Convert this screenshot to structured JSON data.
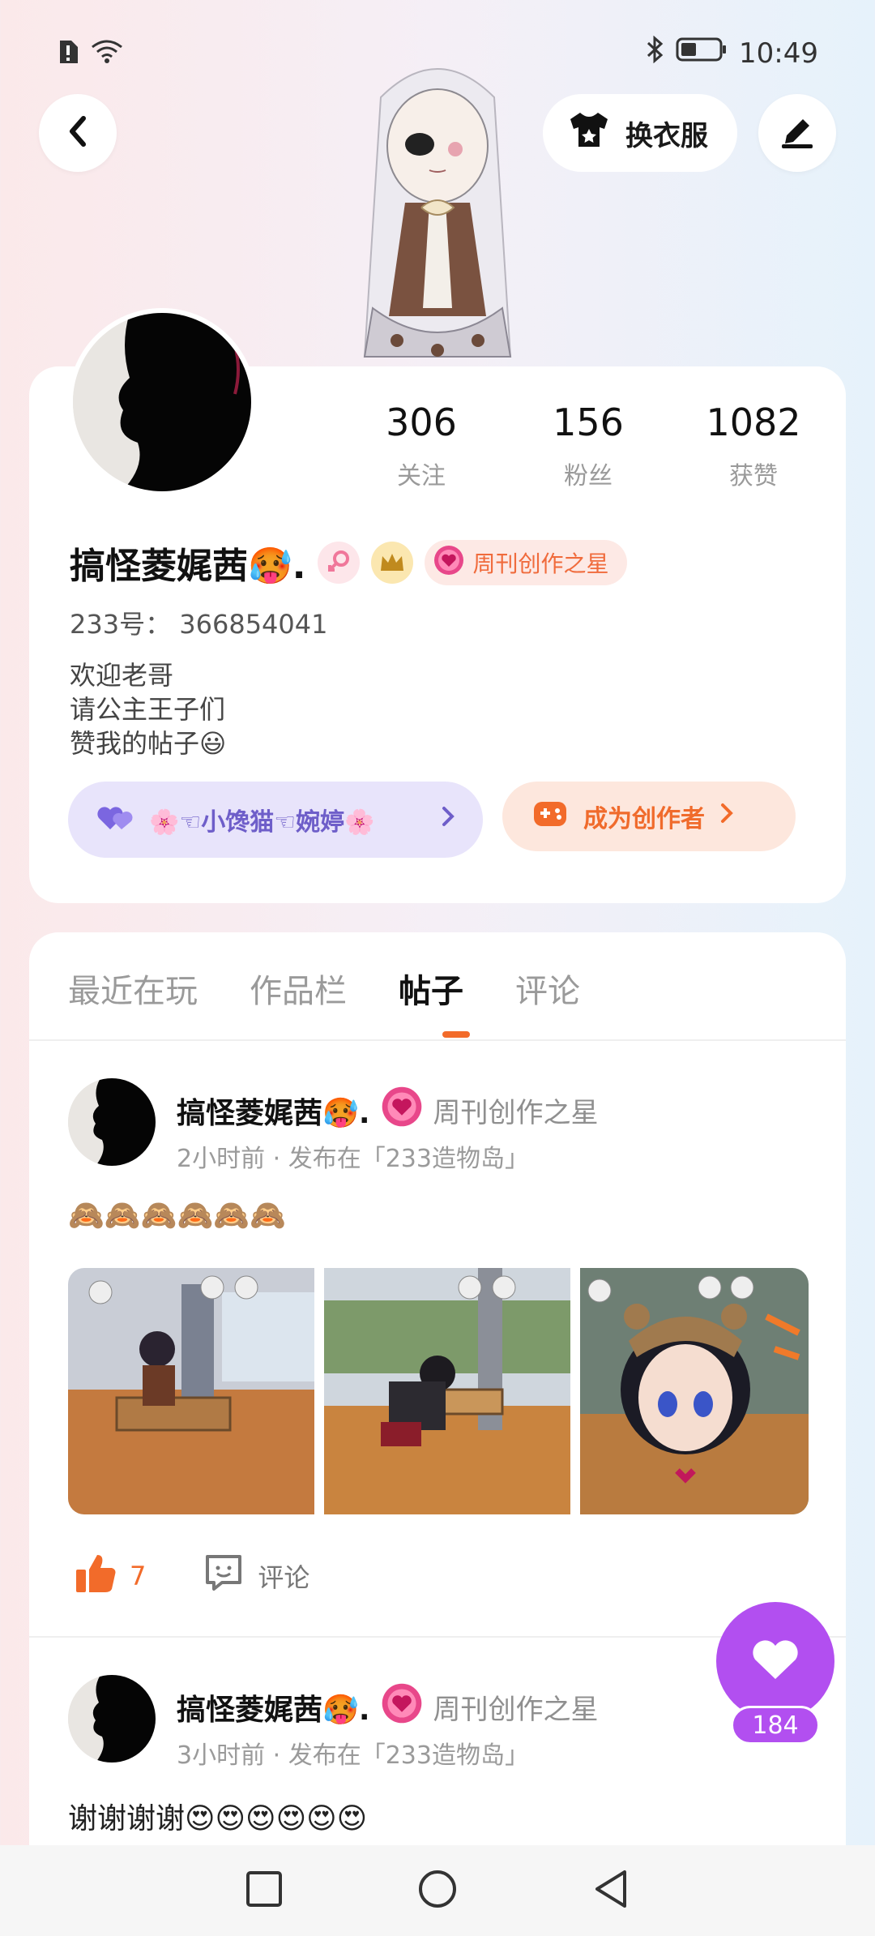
{
  "status_bar": {
    "time": "10:49",
    "icons": [
      "alert-sim-icon",
      "wifi-icon",
      "bluetooth-icon",
      "battery-icon"
    ]
  },
  "header": {
    "back_icon": "chevron-left-icon",
    "dress_up_label": "换衣服",
    "edit_icon": "pen-icon"
  },
  "profile": {
    "stats": [
      {
        "value": "306",
        "label": "关注"
      },
      {
        "value": "156",
        "label": "粉丝"
      },
      {
        "value": "1082",
        "label": "获赞"
      }
    ],
    "username": "搞怪菱娓茜🥵.",
    "badge_label": "周刊创作之星",
    "uid": "233号： 366854041",
    "bio_lines": [
      "欢迎老哥",
      "请公主王子们",
      "赞我的帖子😃"
    ],
    "fan_group_label": "🌸☜小馋猫☜婉婷🌸",
    "creator_label": "成为创作者"
  },
  "tabs": [
    {
      "label": "最近在玩",
      "active": false
    },
    {
      "label": "作品栏",
      "active": false
    },
    {
      "label": "帖子",
      "active": true
    },
    {
      "label": "评论",
      "active": false
    }
  ],
  "posts": [
    {
      "author": "搞怪菱娓茜🥵.",
      "badge": "周刊创作之星",
      "meta": "2小时前 · 发布在「233造物岛」",
      "text": "🙈🙈🙈🙈🙈🙈",
      "likes": "7",
      "comment_label": "评论"
    },
    {
      "author": "搞怪菱娓茜🥵.",
      "badge": "周刊创作之星",
      "meta": "3小时前 · 发布在「233造物岛」",
      "text": "谢谢谢谢😍😍😍😍😍😍"
    }
  ],
  "fab": {
    "count": "184"
  },
  "colors": {
    "accent": "#f26b2a",
    "purple": "#b24ff0",
    "fan_pill": "#e8e4fb"
  }
}
